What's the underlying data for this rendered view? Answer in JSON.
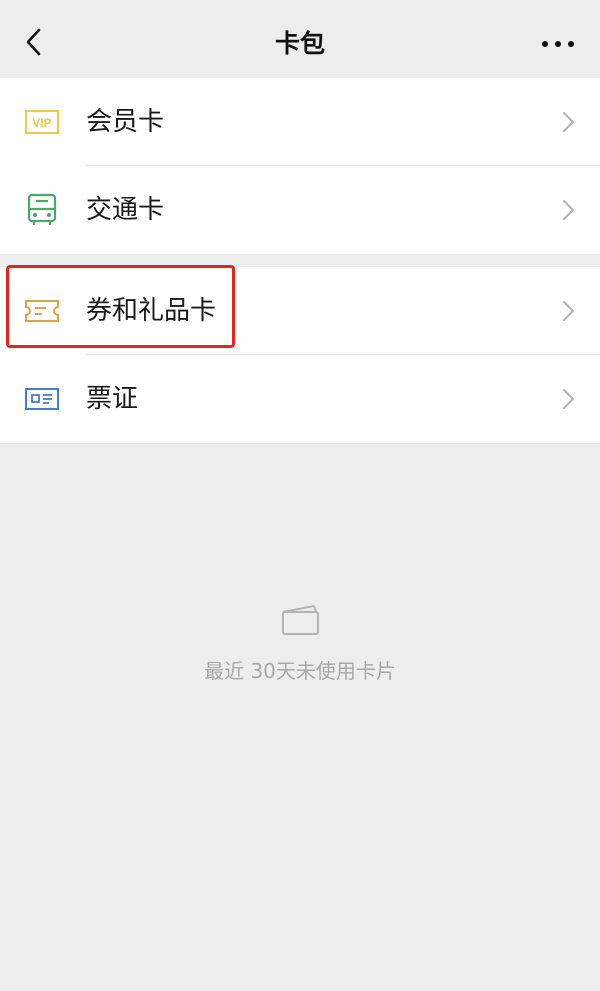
{
  "header": {
    "title": "卡包",
    "back_icon": "chevron-left-icon",
    "more_icon": "more-horizontal-icon"
  },
  "groups": [
    {
      "items": [
        {
          "label": "会员卡",
          "icon": "vip-card-icon",
          "color": "#f2c84b"
        },
        {
          "label": "交通卡",
          "icon": "bus-icon",
          "color": "#4ca86a"
        }
      ]
    },
    {
      "items": [
        {
          "label": "券和礼品卡",
          "icon": "coupon-ticket-icon",
          "color": "#e0a445"
        },
        {
          "label": "票证",
          "icon": "id-card-icon",
          "color": "#3f7fd6"
        }
      ]
    }
  ],
  "highlight_color": "#e8241a",
  "empty_state": {
    "text": "最近 30天未使用卡片",
    "icon": "card-outline-icon"
  }
}
